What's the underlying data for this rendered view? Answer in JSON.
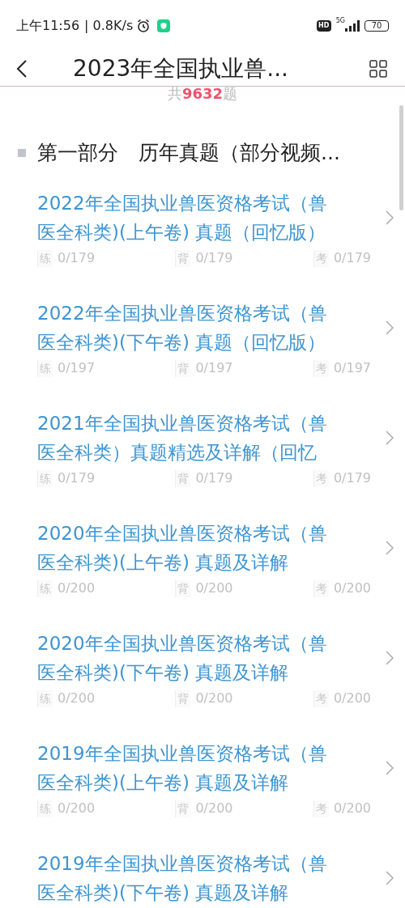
{
  "status_bar": {
    "time": "上午11:56",
    "speed": "| 0.8K/s",
    "hd": "HD",
    "network": "5G",
    "battery": "70"
  },
  "header": {
    "title": "2023年全国执业兽..."
  },
  "total": {
    "prefix": "共",
    "count": "9632",
    "suffix": "题"
  },
  "section": {
    "title": "第一部分　历年真题（部分视频..."
  },
  "items": [
    {
      "title_lines": [
        "2022年全国执业兽医资格考试（兽",
        "医全科类)(上午卷) 真题（回忆版）"
      ],
      "stats": [
        {
          "label": "练",
          "value": "0/179"
        },
        {
          "label": "背",
          "value": "0/179"
        },
        {
          "label": "考",
          "value": "0/179"
        }
      ]
    },
    {
      "title_lines": [
        "2022年全国执业兽医资格考试（兽",
        "医全科类)(下午卷) 真题（回忆版）"
      ],
      "stats": [
        {
          "label": "练",
          "value": "0/197"
        },
        {
          "label": "背",
          "value": "0/197"
        },
        {
          "label": "考",
          "value": "0/197"
        }
      ]
    },
    {
      "title_lines": [
        "2021年全国执业兽医资格考试（兽",
        "医全科类）真题精选及详解（回忆"
      ],
      "stats": [
        {
          "label": "练",
          "value": "0/179"
        },
        {
          "label": "背",
          "value": "0/179"
        },
        {
          "label": "考",
          "value": "0/179"
        }
      ]
    },
    {
      "title_lines": [
        "2020年全国执业兽医资格考试（兽",
        "医全科类)(上午卷) 真题及详解"
      ],
      "stats": [
        {
          "label": "练",
          "value": "0/200"
        },
        {
          "label": "背",
          "value": "0/200"
        },
        {
          "label": "考",
          "value": "0/200"
        }
      ]
    },
    {
      "title_lines": [
        "2020年全国执业兽医资格考试（兽",
        "医全科类)(下午卷) 真题及详解"
      ],
      "stats": [
        {
          "label": "练",
          "value": "0/200"
        },
        {
          "label": "背",
          "value": "0/200"
        },
        {
          "label": "考",
          "value": "0/200"
        }
      ]
    },
    {
      "title_lines": [
        "2019年全国执业兽医资格考试（兽",
        "医全科类)(上午卷) 真题及详解"
      ],
      "stats": [
        {
          "label": "练",
          "value": "0/200"
        },
        {
          "label": "背",
          "value": "0/200"
        },
        {
          "label": "考",
          "value": "0/200"
        }
      ]
    },
    {
      "title_lines": [
        "2019年全国执业兽医资格考试（兽",
        "医全科类)(下午卷) 真题及详解"
      ]
    }
  ]
}
